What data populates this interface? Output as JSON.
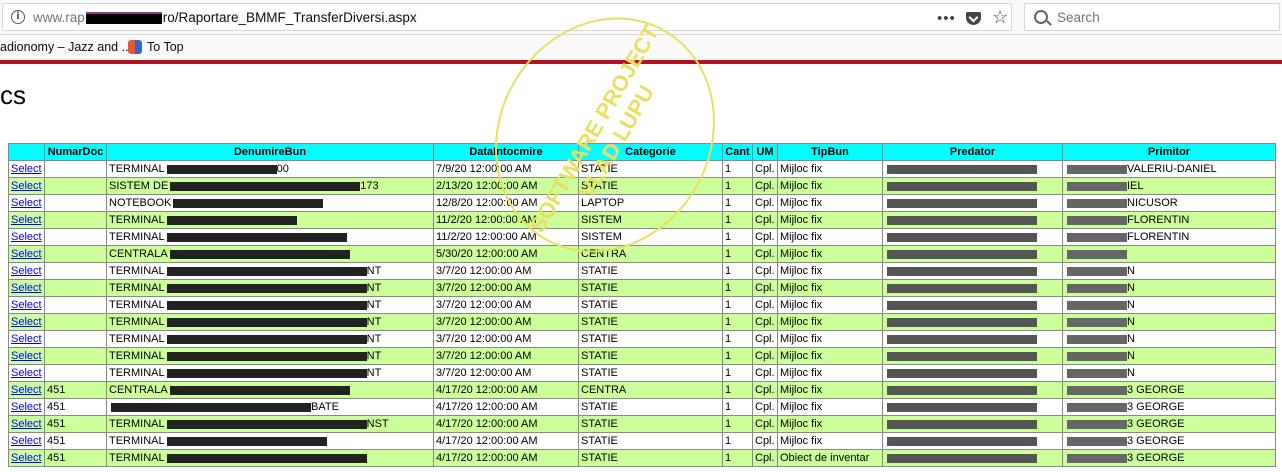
{
  "browser": {
    "url_prefix": "www.rap",
    "url_suffix": "ro/Raportare_BMMF_TransferDiversi.aspx",
    "search_placeholder": "Search",
    "menu_glyph": "•••",
    "star_glyph": "☆"
  },
  "bookmarks": {
    "item1": "adionomy – Jazz and ...",
    "item2": "To Top"
  },
  "page": {
    "title": "cs"
  },
  "watermark": {
    "line1": "SOFTWARE PROJECT",
    "line2": "VLAD LUPU"
  },
  "table": {
    "columns": [
      "",
      "NumarDoc",
      "DenumireBun",
      "DataIntocmire",
      "Categorie",
      "Cant",
      "UM",
      "TipBun",
      "Predator",
      "Primitor"
    ],
    "rows": [
      {
        "select": "Select",
        "doc": "",
        "name": "TERMINAL",
        "name_end": "00",
        "date": "7/9/20",
        "time": "12:00:00 AM",
        "cat": "STATIE",
        "qty": "1",
        "um": "Cpl.",
        "tip": "Mijloc fix",
        "pred": "",
        "prim": "VALERIU-DANIEL"
      },
      {
        "select": "Select",
        "doc": "",
        "name": "SISTEM DE",
        "name_end": "173",
        "date": "2/13/20",
        "time": "12:00:00 AM",
        "cat": "STATIE",
        "qty": "1",
        "um": "Cpl.",
        "tip": "Mijloc fix",
        "pred": "",
        "prim": "IEL"
      },
      {
        "select": "Select",
        "doc": "",
        "name": "NOTEBOOK",
        "name_end": "",
        "date": "12/8/20",
        "time": "12:00:00 AM",
        "cat": "LAPTOP",
        "qty": "1",
        "um": "Cpl.",
        "tip": "Mijloc fix",
        "pred": "",
        "prim": "NICUSOR"
      },
      {
        "select": "Select",
        "doc": "",
        "name": "TERMINAL",
        "name_end": "",
        "date": "11/2/20",
        "time": "12:00:00 AM",
        "cat": "SISTEM",
        "qty": "1",
        "um": "Cpl.",
        "tip": "Mijloc fix",
        "pred": "",
        "prim": "FLORENTIN"
      },
      {
        "select": "Select",
        "doc": "",
        "name": "TERMINAL",
        "name_end": "",
        "date": "11/2/20",
        "time": "12:00:00 AM",
        "cat": "SISTEM",
        "qty": "1",
        "um": "Cpl.",
        "tip": "Mijloc fix",
        "pred": "",
        "prim": "FLORENTIN"
      },
      {
        "select": "Select",
        "doc": "",
        "name": "CENTRALA",
        "name_end": "",
        "date": "5/30/20",
        "time": "12:00:00 AM",
        "cat": "CENTRA",
        "qty": "1",
        "um": "Cpl.",
        "tip": "Mijloc fix",
        "pred": "",
        "prim": ""
      },
      {
        "select": "Select",
        "doc": "",
        "name": "TERMINAL",
        "name_end": "NT",
        "date": "3/7/20",
        "time": "12:00:00 AM",
        "cat": "STATIE",
        "qty": "1",
        "um": "Cpl.",
        "tip": "Mijloc fix",
        "pred": "",
        "prim": "N"
      },
      {
        "select": "Select",
        "doc": "",
        "name": "TERMINAL",
        "name_end": "NT",
        "date": "3/7/20",
        "time": "12:00:00 AM",
        "cat": "STATIE",
        "qty": "1",
        "um": "Cpl.",
        "tip": "Mijloc fix",
        "pred": "",
        "prim": "N"
      },
      {
        "select": "Select",
        "doc": "",
        "name": "TERMINAL",
        "name_end": "NT",
        "date": "3/7/20",
        "time": "12:00:00 AM",
        "cat": "STATIE",
        "qty": "1",
        "um": "Cpl.",
        "tip": "Mijloc fix",
        "pred": "",
        "prim": "N"
      },
      {
        "select": "Select",
        "doc": "",
        "name": "TERMINAL",
        "name_end": "NT",
        "date": "3/7/20",
        "time": "12:00:00 AM",
        "cat": "STATIE",
        "qty": "1",
        "um": "Cpl.",
        "tip": "Mijloc fix",
        "pred": "",
        "prim": "N"
      },
      {
        "select": "Select",
        "doc": "",
        "name": "TERMINAL",
        "name_end": "NT",
        "date": "3/7/20",
        "time": "12:00:00 AM",
        "cat": "STATIE",
        "qty": "1",
        "um": "Cpl.",
        "tip": "Mijloc fix",
        "pred": "",
        "prim": "N"
      },
      {
        "select": "Select",
        "doc": "",
        "name": "TERMINAL",
        "name_end": "NT",
        "date": "3/7/20",
        "time": "12:00:00 AM",
        "cat": "STATIE",
        "qty": "1",
        "um": "Cpl.",
        "tip": "Mijloc fix",
        "pred": "",
        "prim": "N"
      },
      {
        "select": "Select",
        "doc": "",
        "name": "TERMINAL",
        "name_end": "NT",
        "date": "3/7/20",
        "time": "12:00:00 AM",
        "cat": "STATIE",
        "qty": "1",
        "um": "Cpl.",
        "tip": "Mijloc fix",
        "pred": "",
        "prim": "N"
      },
      {
        "select": "Select",
        "doc": "451",
        "name": "CENTRALA",
        "name_end": "",
        "date": "4/17/20",
        "time": "12:00:00 AM",
        "cat": "CENTRA",
        "qty": "1",
        "um": "Cpl.",
        "tip": "Mijloc fix",
        "pred": "",
        "prim": "3 GEORGE"
      },
      {
        "select": "Select",
        "doc": "451",
        "name": "",
        "name_end": "BATE",
        "date": "4/17/20",
        "time": "12:00:00 AM",
        "cat": "STATIE",
        "qty": "1",
        "um": "Cpl.",
        "tip": "Mijloc fix",
        "pred": "",
        "prim": "3 GEORGE"
      },
      {
        "select": "Select",
        "doc": "451",
        "name": "TERMINAL",
        "name_end": "NST",
        "date": "4/17/20",
        "time": "12:00:00 AM",
        "cat": "STATIE",
        "qty": "1",
        "um": "Cpl.",
        "tip": "Mijloc fix",
        "pred": "",
        "prim": "3 GEORGE"
      },
      {
        "select": "Select",
        "doc": "451",
        "name": "TERMINAL",
        "name_end": "",
        "date": "4/17/20",
        "time": "12:00:00 AM",
        "cat": "STATIE",
        "qty": "1",
        "um": "Cpl.",
        "tip": "Mijloc fix",
        "pred": "",
        "prim": "3 GEORGE"
      },
      {
        "select": "Select",
        "doc": "451",
        "name": "TERMINAL",
        "name_end": "",
        "date": "4/17/20",
        "time": "12:00:00 AM",
        "cat": "STATIE",
        "qty": "1",
        "um": "Cpl.",
        "tip": "Obiect de inventar",
        "pred": "",
        "prim": "3 GEORGE"
      }
    ]
  },
  "colors": {
    "header_bg": "#00ffff",
    "alt_row_bg": "#ccff99",
    "accent_line": "#b4121f",
    "link": "#0000ff",
    "watermark": "#e8e060"
  }
}
